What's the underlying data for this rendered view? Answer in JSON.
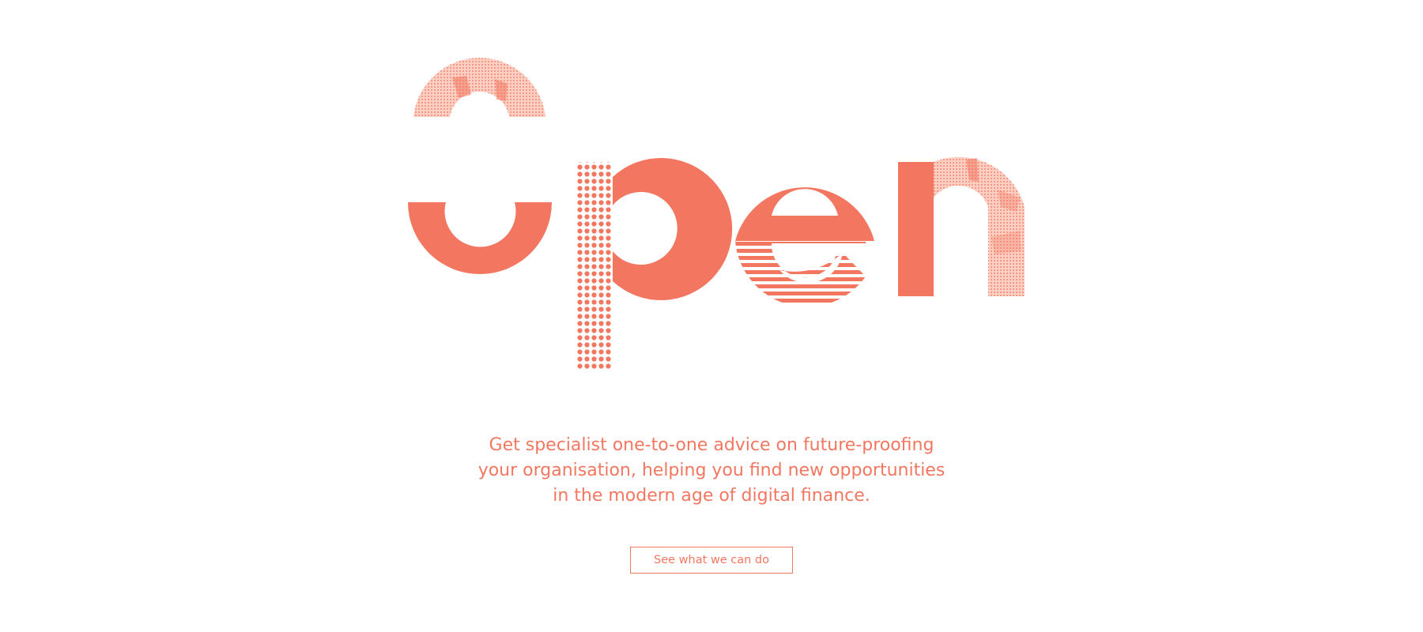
{
  "hero": {
    "word": "Open",
    "accent_color": "#f37760",
    "light_color": "#f9b7a6"
  },
  "tagline": {
    "lines": [
      "Get specialist one-to-one advice on future-proofing",
      "your organisation, helping you find new opportunities",
      "in the modern age of digital finance."
    ]
  },
  "cta": {
    "label": "See what we can do"
  }
}
